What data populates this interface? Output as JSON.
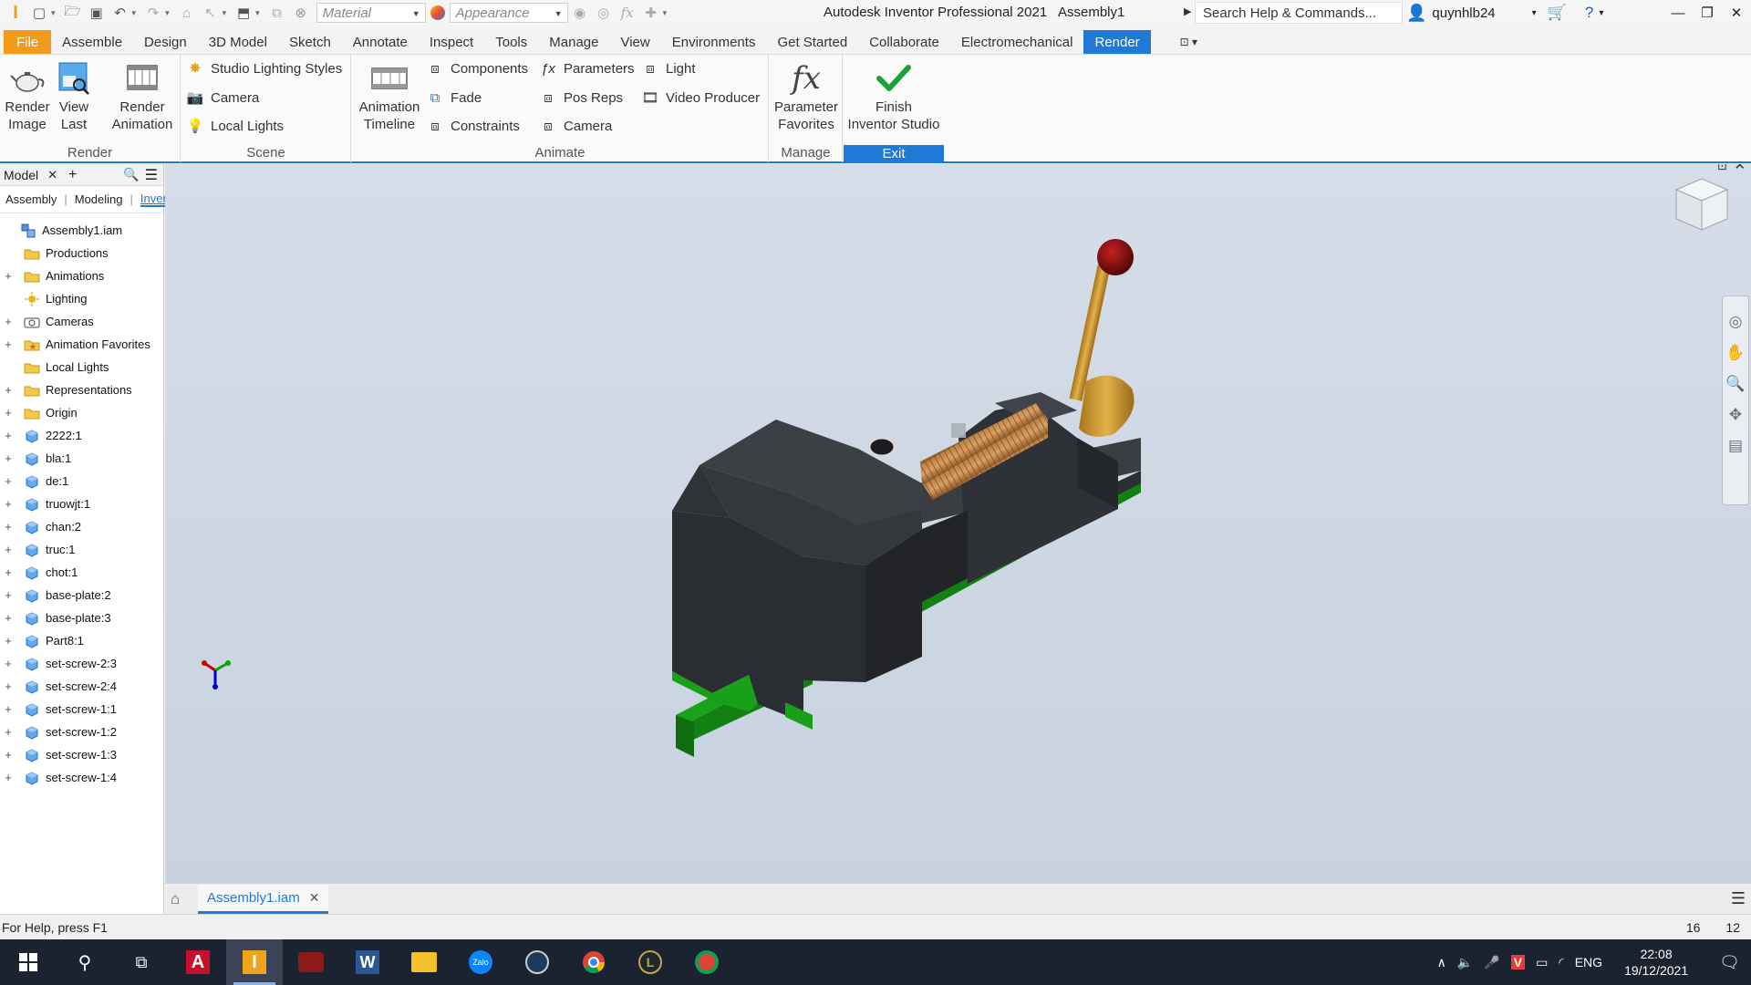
{
  "titlebar": {
    "material_placeholder": "Material",
    "appearance_placeholder": "Appearance",
    "app_title": "Autodesk Inventor Professional 2021",
    "doc_title": "Assembly1",
    "search_placeholder": "Search Help & Commands...",
    "user": "quynhlb24"
  },
  "menu": {
    "tabs": [
      "File",
      "Assemble",
      "Design",
      "3D Model",
      "Sketch",
      "Annotate",
      "Inspect",
      "Tools",
      "Manage",
      "View",
      "Environments",
      "Get Started",
      "Collaborate",
      "Electromechanical",
      "Render"
    ],
    "active": "Render"
  },
  "ribbon": {
    "render_panel": {
      "label": "Render",
      "render_image": "Render\nImage",
      "view_last": "View\nLast",
      "render_animation": "Render\nAnimation"
    },
    "scene_panel": {
      "label": "Scene",
      "studio_lighting": "Studio Lighting Styles",
      "camera": "Camera",
      "local_lights": "Local Lights"
    },
    "animate_panel": {
      "label": "Animate",
      "timeline": "Animation\nTimeline",
      "components": "Components",
      "fade": "Fade",
      "constraints": "Constraints",
      "parameters": "Parameters",
      "pos_reps": "Pos Reps",
      "camera": "Camera",
      "light": "Light",
      "video_producer": "Video Producer"
    },
    "manage_panel": {
      "label": "Manage",
      "param_favorites": "Parameter\nFavorites"
    },
    "exit_panel": {
      "label": "Exit",
      "finish": "Finish\nInventor Studio"
    }
  },
  "browser": {
    "title": "Model",
    "tabs": [
      "Assembly",
      "Modeling",
      "Inver"
    ],
    "tree": [
      {
        "label": "Assembly1.iam",
        "icon": "assembly-icon",
        "expand": "",
        "indent": 0
      },
      {
        "label": "Productions",
        "icon": "folder-icon",
        "expand": "",
        "indent": 1
      },
      {
        "label": "Animations",
        "icon": "folder-icon",
        "expand": "+",
        "indent": 1
      },
      {
        "label": "Lighting",
        "icon": "sun-icon",
        "expand": "",
        "indent": 1
      },
      {
        "label": "Cameras",
        "icon": "camera-icon",
        "expand": "+",
        "indent": 1
      },
      {
        "label": "Animation Favorites",
        "icon": "star-folder-icon",
        "expand": "+",
        "indent": 1
      },
      {
        "label": "Local Lights",
        "icon": "folder-icon",
        "expand": "",
        "indent": 1
      },
      {
        "label": "Representations",
        "icon": "folder-icon",
        "expand": "+",
        "indent": 1
      },
      {
        "label": "Origin",
        "icon": "folder-icon",
        "expand": "+",
        "indent": 1
      },
      {
        "label": "2222:1",
        "icon": "part-icon",
        "expand": "+",
        "indent": 1
      },
      {
        "label": "bla:1",
        "icon": "part-icon",
        "expand": "+",
        "indent": 1
      },
      {
        "label": "de:1",
        "icon": "part-icon",
        "expand": "+",
        "indent": 1
      },
      {
        "label": "truowjt:1",
        "icon": "part-icon",
        "expand": "+",
        "indent": 1
      },
      {
        "label": "chan:2",
        "icon": "part-icon",
        "expand": "+",
        "indent": 1
      },
      {
        "label": "truc:1",
        "icon": "part-icon",
        "expand": "+",
        "indent": 1
      },
      {
        "label": "chot:1",
        "icon": "part-icon",
        "expand": "+",
        "indent": 1
      },
      {
        "label": "base-plate:2",
        "icon": "part-icon",
        "expand": "+",
        "indent": 1
      },
      {
        "label": "base-plate:3",
        "icon": "part-icon",
        "expand": "+",
        "indent": 1
      },
      {
        "label": "Part8:1",
        "icon": "part-icon",
        "expand": "+",
        "indent": 1
      },
      {
        "label": "set-screw-2:3",
        "icon": "part-icon",
        "expand": "+",
        "indent": 1
      },
      {
        "label": "set-screw-2:4",
        "icon": "part-icon",
        "expand": "+",
        "indent": 1
      },
      {
        "label": "set-screw-1:1",
        "icon": "part-icon",
        "expand": "+",
        "indent": 1
      },
      {
        "label": "set-screw-1:2",
        "icon": "part-icon",
        "expand": "+",
        "indent": 1
      },
      {
        "label": "set-screw-1:3",
        "icon": "part-icon",
        "expand": "+",
        "indent": 1
      },
      {
        "label": "set-screw-1:4",
        "icon": "part-icon",
        "expand": "+",
        "indent": 1
      }
    ]
  },
  "doc_tab": {
    "label": "Assembly1.iam"
  },
  "status": {
    "help": "For Help, press F1",
    "num1": "16",
    "num2": "12"
  },
  "taskbar": {
    "lang": "ENG",
    "time": "22:08",
    "date": "19/12/2021"
  },
  "colors": {
    "accent": "#1f7ad7",
    "file_tab": "#f29a1c",
    "vise_body": "#2c2f33",
    "base_green": "#1aa31a",
    "brass": "#c8962a",
    "knob_red": "#8c0c0c"
  }
}
